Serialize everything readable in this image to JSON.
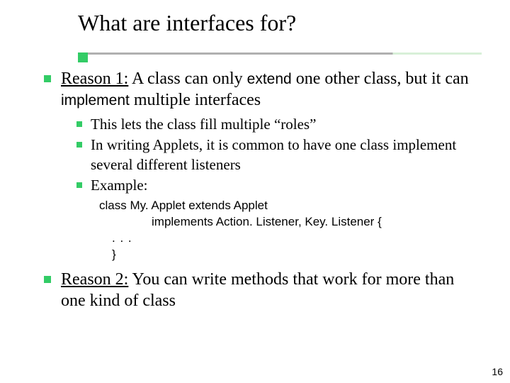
{
  "title": "What are interfaces for?",
  "reason1": {
    "label": "Reason 1:",
    "pre": " A class can only ",
    "kw1": "extend",
    "mid": " one other class, but it can ",
    "kw2": "implement",
    "post": " multiple interfaces"
  },
  "sub": {
    "a": "This lets the class fill multiple “roles”",
    "b": "In writing Applets, it is common to have one class implement several different listeners",
    "c": "Example:"
  },
  "code": {
    "l1": "class My. Applet extends Applet",
    "l2": "implements Action. Listener, Key. Listener {",
    "l3": ". . .",
    "l4": "}"
  },
  "reason2": {
    "label": "Reason 2:",
    "text": " You can write methods that work for more than one kind of class"
  },
  "page_number": "16",
  "colors": {
    "accent": "#33cc66"
  }
}
